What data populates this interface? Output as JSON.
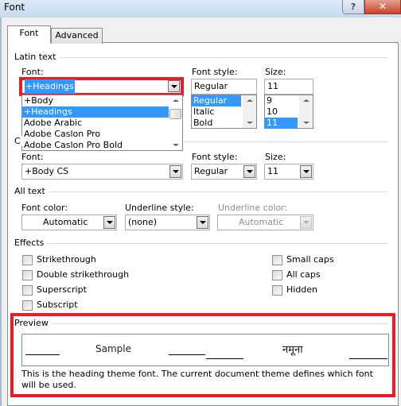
{
  "window": {
    "title": "Font",
    "help_glyph": "?",
    "close_glyph": "✕"
  },
  "tabs": [
    {
      "label": "Font",
      "active": true
    },
    {
      "label": "Advanced",
      "active": false
    }
  ],
  "latin": {
    "group_label": "Latin text",
    "font_label": "Font:",
    "font_value": "+Headings",
    "font_list": [
      "+Body",
      "+Headings",
      "Adobe Arabic",
      "Adobe Caslon Pro",
      "Adobe Caslon Pro Bold"
    ],
    "font_list_selected": "+Headings",
    "style_label": "Font style:",
    "style_value": "Regular",
    "style_list": [
      "Regular",
      "Italic",
      "Bold"
    ],
    "style_list_selected": "Regular",
    "size_label": "Size:",
    "size_value": "11",
    "size_list": [
      "9",
      "10",
      "11"
    ],
    "size_list_selected": "11"
  },
  "complex": {
    "group_label_visible": "C",
    "font_label": "Font:",
    "font_value": "+Body CS",
    "style_label": "Font style:",
    "style_value": "Regular",
    "size_label": "Size:",
    "size_value": "11"
  },
  "all_text": {
    "group_label": "All text",
    "font_color_label": "Font color:",
    "font_color_value": "Automatic",
    "underline_style_label": "Underline style:",
    "underline_style_value": "(none)",
    "underline_color_label": "Underline color:",
    "underline_color_value": "Automatic"
  },
  "effects": {
    "group_label": "Effects",
    "left": [
      {
        "label": "Strikethrough",
        "checked": false
      },
      {
        "label": "Double strikethrough",
        "checked": false
      },
      {
        "label": "Superscript",
        "checked": false
      },
      {
        "label": "Subscript",
        "checked": false
      }
    ],
    "right": [
      {
        "label": "Small caps",
        "checked": false
      },
      {
        "label": "All caps",
        "checked": false
      },
      {
        "label": "Hidden",
        "checked": false
      }
    ]
  },
  "preview": {
    "group_label": "Preview",
    "sample_latin": "Sample",
    "sample_complex": "नमूना",
    "description": "This is the heading theme font. The current document theme defines which font will be used."
  },
  "highlight_color": "#ed1c24",
  "selection_color": "#3399ff"
}
